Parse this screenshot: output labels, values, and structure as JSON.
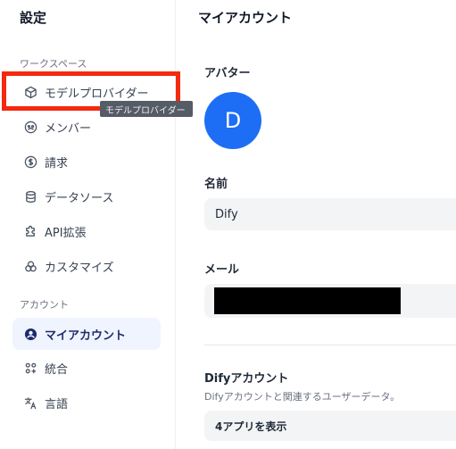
{
  "sidebar": {
    "title": "設定",
    "sections": {
      "workspace": "ワークスペース",
      "account": "アカウント"
    },
    "items": [
      {
        "label": "モデルプロバイダー",
        "icon": "cube-icon"
      },
      {
        "label": "メンバー",
        "icon": "members-icon"
      },
      {
        "label": "請求",
        "icon": "billing-icon"
      },
      {
        "label": "データソース",
        "icon": "database-icon"
      },
      {
        "label": "API拡張",
        "icon": "puzzle-icon"
      },
      {
        "label": "カスタマイズ",
        "icon": "customize-icon"
      },
      {
        "label": "マイアカウント",
        "icon": "user-icon",
        "active": true
      },
      {
        "label": "統合",
        "icon": "integrations-icon"
      },
      {
        "label": "言語",
        "icon": "language-icon"
      }
    ],
    "tooltip": "モデルプロバイダー"
  },
  "main": {
    "title": "マイアカウント",
    "avatar_label": "アバター",
    "avatar_initial": "D",
    "name_label": "名前",
    "name_value": "Dify",
    "email_label": "メール",
    "dify_account_title": "Difyアカウント",
    "dify_account_desc": "Difyアカウントと関連するユーザーデータ。",
    "apps_button": "4アプリを表示"
  },
  "colors": {
    "accent": "#1d6ef5",
    "active_bg": "#eff4ff",
    "highlight": "#f4290f"
  }
}
